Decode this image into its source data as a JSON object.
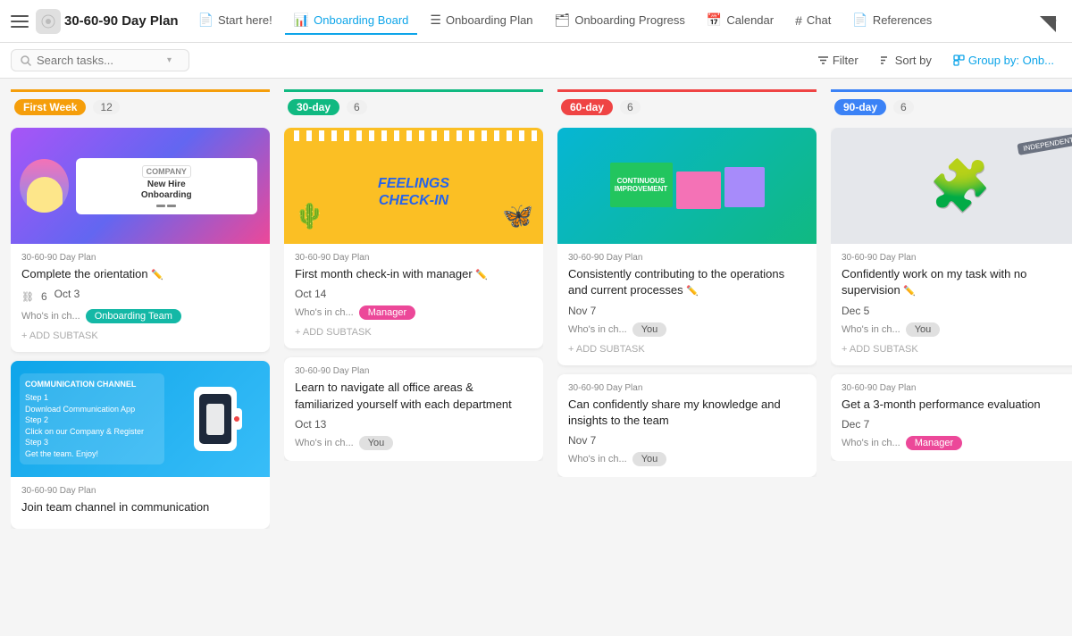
{
  "app": {
    "title": "30-60-90 Day Plan",
    "icon": "📋"
  },
  "nav": {
    "tabs": [
      {
        "id": "start-here",
        "label": "Start here!",
        "icon": "📄",
        "active": false
      },
      {
        "id": "onboarding-board",
        "label": "Onboarding Board",
        "icon": "📊",
        "active": true
      },
      {
        "id": "onboarding-plan",
        "label": "Onboarding Plan",
        "icon": "☰",
        "active": false
      },
      {
        "id": "onboarding-progress",
        "label": "Onboarding Progress",
        "icon": "🗂",
        "active": false
      },
      {
        "id": "calendar",
        "label": "Calendar",
        "icon": "📅",
        "active": false
      },
      {
        "id": "chat",
        "label": "Chat",
        "icon": "#",
        "active": false
      },
      {
        "id": "references",
        "label": "References",
        "icon": "📄",
        "active": false
      }
    ],
    "plus": "+"
  },
  "toolbar": {
    "search_placeholder": "Search tasks...",
    "filter_label": "Filter",
    "sort_label": "Sort by",
    "group_label": "Group by: Onb..."
  },
  "columns": [
    {
      "id": "first-week",
      "badge_label": "First Week",
      "badge_class": "badge-yellow",
      "border_color": "#f59e0b",
      "count": 12,
      "cards": [
        {
          "id": "card-1",
          "img_type": "onboarding",
          "meta": "30-60-90 Day Plan",
          "title": "Complete the orientation",
          "has_subtask_count": true,
          "subtask_count": "6",
          "date": "Oct 3",
          "who_label": "Who's in ch...",
          "badge_label": "Onboarding Team",
          "badge_class": "badge-teal",
          "add_subtask": "+ ADD SUBTASK"
        },
        {
          "id": "card-2",
          "img_type": "communication",
          "meta": "30-60-90 Day Plan",
          "title": "Join team channel in communication",
          "has_subtask_count": false,
          "date": "",
          "who_label": "",
          "badge_label": "",
          "badge_class": "",
          "add_subtask": ""
        }
      ]
    },
    {
      "id": "30-day",
      "badge_label": "30-day",
      "badge_class": "badge-green",
      "border_color": "#10b981",
      "count": 6,
      "cards": [
        {
          "id": "card-3",
          "img_type": "feelings",
          "meta": "30-60-90 Day Plan",
          "title": "First month check-in with manager",
          "has_subtask_count": false,
          "date": "Oct 14",
          "who_label": "Who's in ch...",
          "badge_label": "Manager",
          "badge_class": "badge-pink",
          "add_subtask": "+ ADD SUBTASK"
        },
        {
          "id": "card-4",
          "img_type": "none",
          "meta": "30-60-90 Day Plan",
          "title": "Learn to navigate all office areas & familiarized yourself with each department",
          "has_subtask_count": false,
          "date": "Oct 13",
          "who_label": "Who's in ch...",
          "badge_label": "You",
          "badge_class": "badge-gray",
          "add_subtask": ""
        }
      ]
    },
    {
      "id": "60-day",
      "badge_label": "60-day",
      "badge_class": "badge-red",
      "border_color": "#ef4444",
      "count": 6,
      "cards": [
        {
          "id": "card-5",
          "img_type": "continuous",
          "meta": "30-60-90 Day Plan",
          "title": "Consistently contributing to the operations and current processes",
          "has_subtask_count": false,
          "date": "Nov 7",
          "who_label": "Who's in ch...",
          "badge_label": "You",
          "badge_class": "badge-gray",
          "add_subtask": "+ ADD SUBTASK"
        },
        {
          "id": "card-6",
          "img_type": "none",
          "meta": "30-60-90 Day Plan",
          "title": "Can confidently share my knowledge and insights to the team",
          "has_subtask_count": false,
          "date": "Nov 7",
          "who_label": "Who's in ch...",
          "badge_label": "You",
          "badge_class": "badge-gray",
          "add_subtask": ""
        }
      ]
    },
    {
      "id": "90-day",
      "badge_label": "90-day",
      "badge_class": "badge-blue",
      "border_color": "#3b82f6",
      "count": 6,
      "cards": [
        {
          "id": "card-7",
          "img_type": "independent",
          "meta": "30-60-90 Day Plan",
          "title": "Confidently work on my task with no supervision",
          "has_subtask_count": false,
          "date": "Dec 5",
          "who_label": "Who's in ch...",
          "badge_label": "You",
          "badge_class": "badge-gray",
          "add_subtask": "+ ADD SUBTASK"
        },
        {
          "id": "card-8",
          "img_type": "none",
          "meta": "30-60-90 Day Plan",
          "title": "Get a 3-month performance evaluation",
          "has_subtask_count": false,
          "date": "Dec 7",
          "who_label": "Who's in ch...",
          "badge_label": "Manager",
          "badge_class": "badge-pink",
          "add_subtask": ""
        }
      ]
    }
  ]
}
